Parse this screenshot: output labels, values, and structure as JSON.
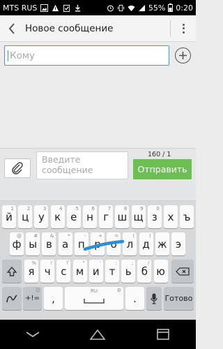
{
  "status": {
    "carrier": "MTS RUS",
    "battery": "55%",
    "time": "0:20"
  },
  "header": {
    "title": "Новое сообщение"
  },
  "recipient": {
    "placeholder": "Кому"
  },
  "composer": {
    "placeholder": "Введите сообщение",
    "counter": "160 / 1",
    "send_label": "Отправить"
  },
  "keyboard": {
    "row1": [
      [
        "й",
        "1"
      ],
      [
        "ц",
        "2"
      ],
      [
        "у",
        "3"
      ],
      [
        "к",
        "4"
      ],
      [
        "е",
        "5"
      ],
      [
        "н",
        "6"
      ],
      [
        "г",
        "7"
      ],
      [
        "ш",
        "8"
      ],
      [
        "щ",
        "9"
      ],
      [
        "з",
        "0"
      ],
      [
        "х",
        ""
      ],
      [
        "ъ",
        ""
      ]
    ],
    "row2": [
      [
        "ф",
        "@"
      ],
      [
        "ы",
        "#"
      ],
      [
        "в",
        "&"
      ],
      [
        "а",
        "*"
      ],
      [
        "п",
        "-"
      ],
      [
        "р",
        "+"
      ],
      [
        "о",
        "="
      ],
      [
        "л",
        "("
      ],
      [
        "д",
        ")"
      ],
      [
        "ж",
        ""
      ],
      [
        "э",
        ""
      ]
    ],
    "row3": [
      [
        "я",
        "%"
      ],
      [
        "ч",
        "!"
      ],
      [
        "с",
        "?"
      ],
      [
        "м",
        "\""
      ],
      [
        "и",
        "'"
      ],
      [
        "т",
        ":"
      ],
      [
        "ь",
        ";"
      ],
      [
        "б",
        "/"
      ],
      [
        "ю",
        ""
      ]
    ],
    "comma": ",",
    "period": ".",
    "space_lang": "RU",
    "sym_label": "+!=",
    "done_label": "Готово"
  },
  "icons": {
    "back": "back-arrow-icon",
    "menu": "overflow-menu-icon",
    "add": "add-contact-icon",
    "attach": "paperclip-icon",
    "shift": "shift-icon",
    "backspace": "backspace-icon",
    "mic": "microphone-icon",
    "gesture": "swipe-gesture-icon"
  },
  "colors": {
    "accent": "#3a9bd8",
    "send": "#6dbf55",
    "swipe_trail": "#2a8fd4"
  }
}
